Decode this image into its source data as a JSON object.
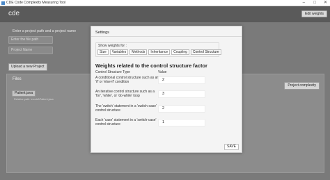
{
  "window": {
    "title": "CDE Code Complexity Measuring Tool",
    "minimize_glyph": "–",
    "maximize_glyph": "□",
    "close_glyph": "✕"
  },
  "header": {
    "app_name": "cde",
    "edit_weights_label": "Edit weights"
  },
  "project": {
    "section_label": "Enter a project path and a project name",
    "file_path_placeholder": "Enter the file path",
    "project_name_placeholder": "Project Name",
    "upload_label": "Upload a new Project"
  },
  "files": {
    "label": "Files",
    "file_button": "Patient.java",
    "relative_path": "Relative path: \\model\\Patient.java",
    "complexity_label": "Project complexity"
  },
  "dialog": {
    "title": "Settings",
    "show_weights_label": "Show weights for :",
    "tabs": [
      "Size",
      "Variables",
      "Methods",
      "Inheritance",
      "Coupling",
      "Control Structure"
    ],
    "heading": "Weights related to the control structure factor",
    "col_type": "Control Structure Type",
    "col_value": "Value",
    "rows": [
      {
        "label": "A conditional control structure such as an 'if' or 'else-if' condition",
        "value": "2"
      },
      {
        "label": "An iterative control structure such as a 'for', 'while', or 'do-while' loop",
        "value": "3"
      },
      {
        "label": "The 'switch' statement in a 'switch-case' control structure",
        "value": "2"
      },
      {
        "label": "Each 'case' statement in a 'switch-case' control structure",
        "value": "1"
      }
    ],
    "save_label": "SAVE"
  }
}
